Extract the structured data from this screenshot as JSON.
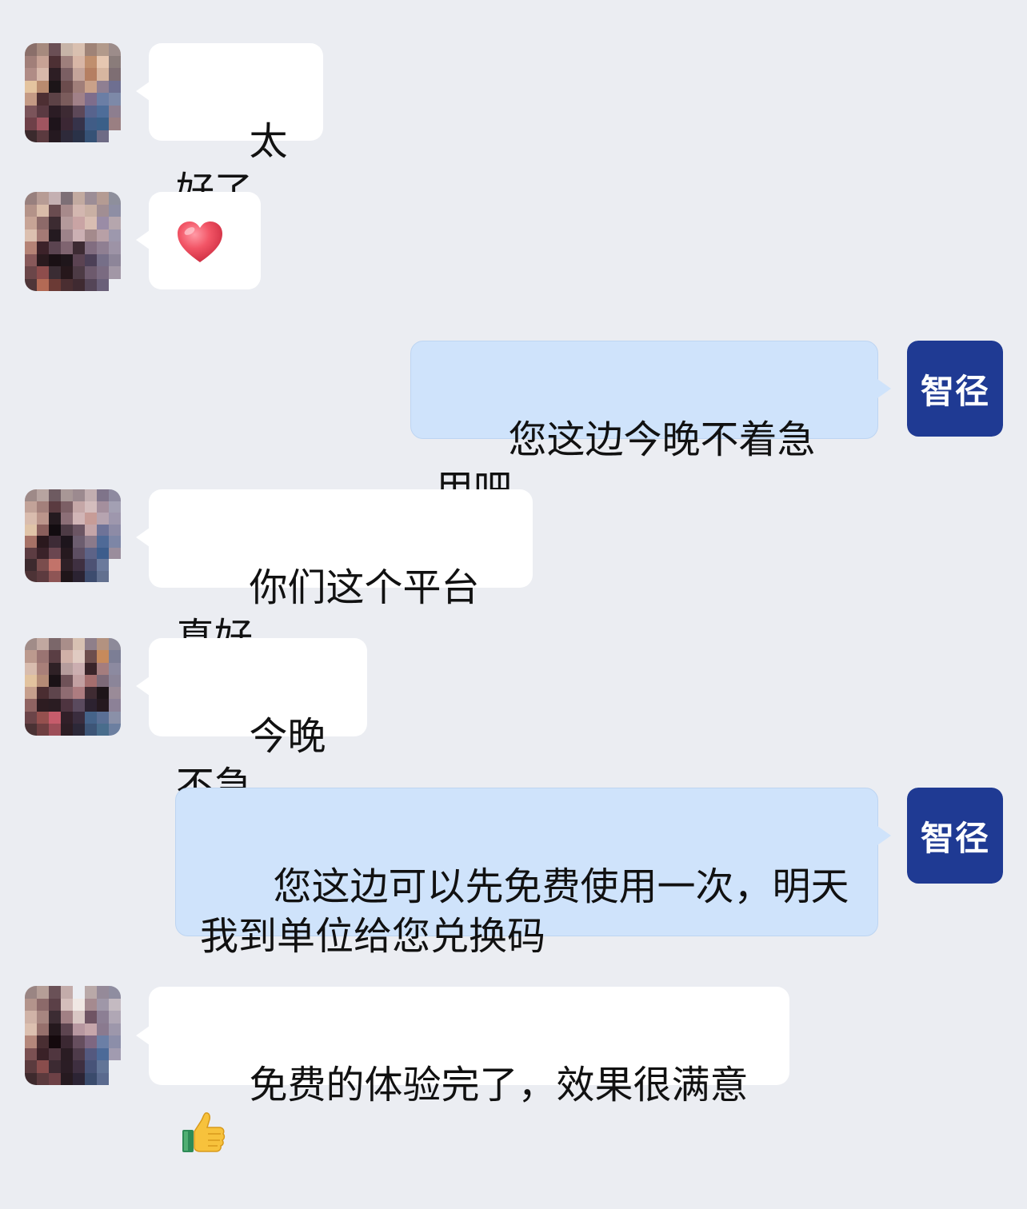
{
  "messages": [
    {
      "side": "left",
      "text": "太好了"
    },
    {
      "side": "left",
      "emoji": "red-heart"
    },
    {
      "side": "right",
      "text": "您这边今晚不着急用吧",
      "sender_label": "智径"
    },
    {
      "side": "left",
      "text": "你们这个平台真好"
    },
    {
      "side": "left",
      "text": "今晚不急"
    },
    {
      "side": "right",
      "text": "您这边可以先免费使用一次，明天\n我到单位给您兑换码",
      "sender_label": "智径"
    },
    {
      "side": "left",
      "text": "免费的体验完了，效果很满意",
      "emoji": "thumbs-up"
    }
  ],
  "colors": {
    "background": "#ebedf2",
    "incoming_bubble": "#ffffff",
    "outgoing_bubble": "#cfe3fb",
    "brand_avatar": "#1f3a93"
  }
}
